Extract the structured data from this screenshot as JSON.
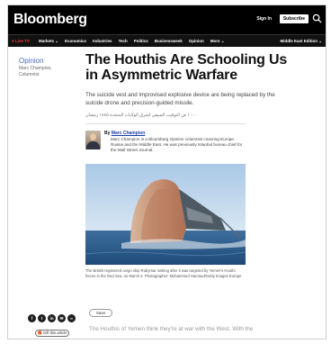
{
  "header": {
    "logo": "Bloomberg",
    "signin": "Sign In",
    "subscribe": "Subscribe"
  },
  "nav": {
    "live": "● Live TV",
    "items": [
      "Markets ⌄",
      "Economics",
      "Industries",
      "Tech",
      "Politics",
      "Businessweek",
      "Opinion",
      "More ⌄"
    ],
    "edition": "Middle East Edition ⌄"
  },
  "sidebar": {
    "section": "Opinion",
    "author_name": "Marc Champion,",
    "author_role": "Columnist"
  },
  "article": {
    "headline": "The Houthis Are Schooling Us in Asymmetric Warfare",
    "dek": "The suicide vest and improvised explosive device are being replaced by the suicide drone and precision-guided missile.",
    "dateline": "١٠:٠٠ ص التوقيت الصيفي لشرق الولايات المتحدة ١٤٤٥ رمضان",
    "bio_prefix": "By",
    "bio_name": "Marc Champion",
    "bio_text": "Marc Champion is a Bloomberg Opinion columnist covering Europe, Russia and the Middle East. He was previously Istanbul bureau chief for the Wall Street Journal.",
    "caption": "The British-registered cargo ship Rubymar sinking after it was targeted by Yemen's Houthi forces in the Red Sea, on March 2. Photographer: Mohammed Hamoud/Getty Images Europe",
    "save_label": "Save",
    "body_start": "The Houthis of Yemen think they're at war with the West. With the"
  },
  "share": {
    "icons": [
      "f",
      "t",
      "in",
      "✉",
      "∞"
    ],
    "gift_label": "🎁 Gift this article"
  },
  "colors": {
    "accent": "#4a6fbf",
    "live": "#ff3b3b",
    "link": "#1a3ea8"
  }
}
